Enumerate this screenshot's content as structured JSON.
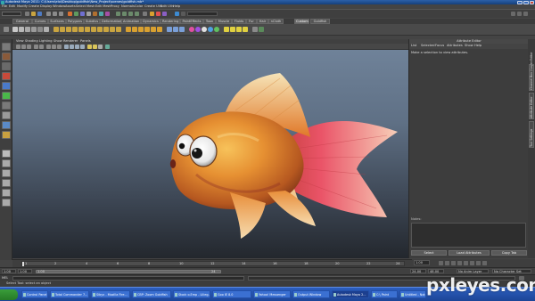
{
  "window": {
    "title": "Autodesk Maya 2011: C:\\Users\\eloi\\Desktop\\goldfish\\New_Project\\scenes\\goldfish.mb*"
  },
  "menubar": {
    "items": [
      "File",
      "Edit",
      "Modify",
      "Create",
      "Display",
      "Window",
      "Assets",
      "Select",
      "Mesh",
      "Edit Mesh",
      "Proxy",
      "Normals",
      "Color",
      "Create UVs",
      "Edit UVs",
      "Help"
    ]
  },
  "shelf": {
    "tabs": [
      "General",
      "Curves",
      "Surfaces",
      "Polygons",
      "Subdivs",
      "Deformation",
      "Animation",
      "Dynamics",
      "Rendering",
      "PaintEffects",
      "Toon",
      "Muscle",
      "Fluids",
      "Fur",
      "Hair",
      "nCloth",
      "Custom",
      "Goldfish"
    ],
    "active_tab": "Custom"
  },
  "panel": {
    "menu": [
      "View",
      "Shading",
      "Lighting",
      "Show",
      "Renderer",
      "Panels"
    ]
  },
  "attribute_editor": {
    "title": "Attribute Editor",
    "menu": [
      "List",
      "Selected",
      "Focus",
      "Attributes",
      "Show",
      "Help"
    ],
    "message": "Make a selection to view attributes.",
    "notes_label": "Notes:",
    "buttons": [
      "Select",
      "Load Attributes",
      "Copy Tab"
    ]
  },
  "side_tabs": [
    "Channel Box / Layer Editor",
    "Attribute Editor",
    "Tool Settings"
  ],
  "timeline": {
    "ticks": [
      "1",
      "2",
      "4",
      "6",
      "8",
      "10",
      "12",
      "14",
      "16",
      "18",
      "20",
      "22",
      "24"
    ],
    "current_frame": "1.00"
  },
  "range": {
    "start": "1.00",
    "inner_start": "1.00",
    "inner_end": "24",
    "end_a": "24.00",
    "end_b": "48.00",
    "anim_layer": "No Anim Layer",
    "char_set": "No Character Set"
  },
  "command": {
    "label": "MEL"
  },
  "helpline": {
    "text": "Select Tool: select an object"
  },
  "taskbar": {
    "items": [
      "Control Panel",
      "Total Commander 7...",
      "Sibyx - Mozilla Fire...",
      "CBP: Zoom Goldfish",
      "Stock o.Emp - Lilieg...",
      "Goo IE 8.0",
      "Yahoo! Messenger",
      "Output Window",
      "Autodesk Maya 2...",
      "C:\\ Paint",
      "Untitled - Notepad"
    ],
    "active_index": 8
  },
  "watermark": "pxleyes.com",
  "colors": {
    "viewport_top": "#6f8299",
    "viewport_bottom": "#23272d",
    "taskbar": "#2c5ebf",
    "fish_body": "#e0892a",
    "fish_fin": "#e0405a"
  }
}
